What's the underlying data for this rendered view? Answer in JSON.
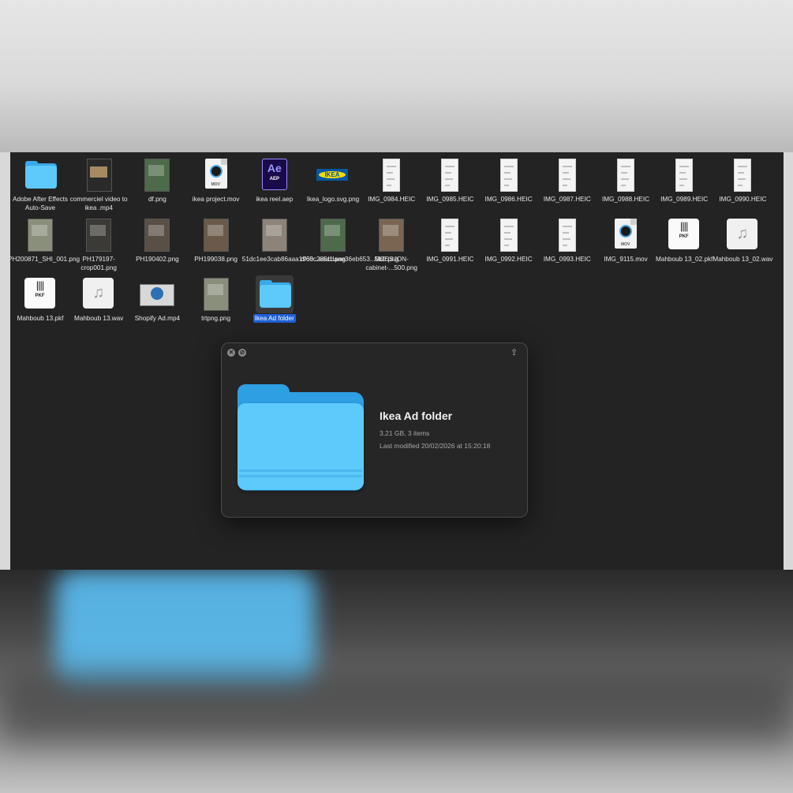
{
  "files": [
    {
      "name": "Adobe After Effects Auto-Save",
      "kind": "folder"
    },
    {
      "name": "commerciel video to ikea .mp4",
      "kind": "video"
    },
    {
      "name": "df.png",
      "kind": "photo"
    },
    {
      "name": "ikea project.mov",
      "kind": "mov"
    },
    {
      "name": "ikea reel.aep",
      "kind": "aep"
    },
    {
      "name": "Ikea_logo.svg.png",
      "kind": "logo"
    },
    {
      "name": "IMG_0984.HEIC",
      "kind": "heic"
    },
    {
      "name": "IMG_0985.HEIC",
      "kind": "heic"
    },
    {
      "name": "IMG_0986.HEIC",
      "kind": "heic"
    },
    {
      "name": "IMG_0987.HEIC",
      "kind": "heic"
    },
    {
      "name": "IMG_0988.HEIC",
      "kind": "heic"
    },
    {
      "name": "IMG_0989.HEIC",
      "kind": "heic"
    },
    {
      "name": "IMG_0990.HEIC",
      "kind": "heic"
    },
    {
      "name": "PH200871_SHI_001.png",
      "kind": "photo"
    },
    {
      "name": "PH179197-crop001.png",
      "kind": "photo"
    },
    {
      "name": "PH190402.png",
      "kind": "photo"
    },
    {
      "name": "PH199038.png",
      "kind": "photo"
    },
    {
      "name": "51dc1ee3cab86aaa1960...ead1.png",
      "kind": "photo"
    },
    {
      "name": "df68c285cdaae36eb653...5b0.png",
      "kind": "photo"
    },
    {
      "name": "MOSSJON-cabinet-...500.png",
      "kind": "photo"
    },
    {
      "name": "IMG_0991.HEIC",
      "kind": "heic"
    },
    {
      "name": "IMG_0992.HEIC",
      "kind": "heic"
    },
    {
      "name": "IMG_0993.HEIC",
      "kind": "heic"
    },
    {
      "name": "IMG_9115.mov",
      "kind": "mov"
    },
    {
      "name": "Mahboub 13_02.pkf",
      "kind": "pkf"
    },
    {
      "name": "Mahboub 13_02.wav",
      "kind": "audio"
    },
    {
      "name": "Mahboub 13.pkf",
      "kind": "pkf"
    },
    {
      "name": "Mahboub 13.wav",
      "kind": "audio"
    },
    {
      "name": "Shopify Ad.mp4",
      "kind": "video"
    },
    {
      "name": "trtpng.png",
      "kind": "photo"
    },
    {
      "name": "Ikea Ad folder",
      "kind": "folder",
      "selected": true
    }
  ],
  "icons": {
    "mov_badge": "MOV",
    "aep_text": "Ae",
    "aep_sub": "AEP",
    "logo_text": "IKEA",
    "pkf_text": "PKF",
    "audio_glyph": "♫",
    "close_glyph": "✕",
    "fullscreen_glyph": "⊘",
    "share_glyph": "⇪"
  },
  "colors": {
    "folder_front": "#5ec9fb",
    "folder_back": "#3aa9ea",
    "selection": "#1f5fd6",
    "window_bg": "#232323"
  },
  "quicklook": {
    "title": "Ikea Ad folder",
    "subtitle": "3,21 GB, 3 items",
    "modified": "Last modified 20/02/2026 at 15:20:18"
  }
}
